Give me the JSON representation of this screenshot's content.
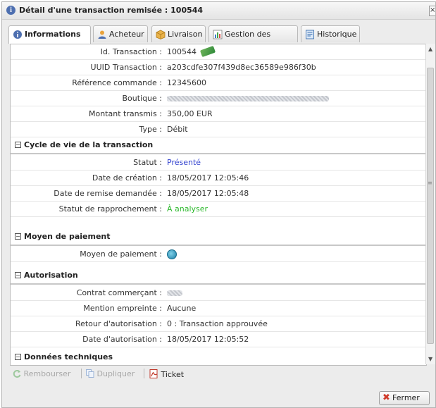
{
  "window": {
    "title": "Détail d'une transaction remisée : 100544",
    "close_glyph": "×"
  },
  "tabs": [
    {
      "label": "Informations",
      "icon": "info-icon",
      "active": true
    },
    {
      "label": "Acheteur",
      "icon": "user-icon"
    },
    {
      "label": "Livraison",
      "icon": "package-icon"
    },
    {
      "label": "Gestion des risques",
      "icon": "chart-icon"
    },
    {
      "label": "Historique",
      "icon": "history-icon"
    }
  ],
  "info": [
    {
      "label": "Id. Transaction :",
      "value": "100544"
    },
    {
      "label": "UUID Transaction :",
      "value": "a203cdfe307f439d8ec36589e986f30b"
    },
    {
      "label": "Référence commande :",
      "value": "12345600"
    },
    {
      "label": "Boutique :",
      "value": ""
    },
    {
      "label": "Montant transmis :",
      "value": "350,00 EUR"
    },
    {
      "label": "Type :",
      "value": "Débit"
    }
  ],
  "sections": {
    "cycle": "Cycle de vie de la transaction",
    "moyen": "Moyen de paiement",
    "autorisation": "Autorisation",
    "donnees": "Données techniques"
  },
  "cycle": [
    {
      "label": "Statut :",
      "value": "Présenté"
    },
    {
      "label": "Date de création :",
      "value": "18/05/2017 12:05:46"
    },
    {
      "label": "Date de remise demandée :",
      "value": "18/05/2017 12:05:48"
    },
    {
      "label": "Statut de rapprochement :",
      "value": "À analyser"
    }
  ],
  "moyen": [
    {
      "label": "Moyen de paiement :",
      "value": ""
    }
  ],
  "autorisation": [
    {
      "label": "Contrat commerçant :",
      "value": ""
    },
    {
      "label": "Mention empreinte :",
      "value": "Aucune"
    },
    {
      "label": "Retour d'autorisation :",
      "value": "0 : Transaction approuvée"
    },
    {
      "label": "Date d'autorisation :",
      "value": "18/05/2017 12:05:52"
    }
  ],
  "toolbar": {
    "rembourser": "Rembourser",
    "dupliquer": "Dupliquer",
    "ticket": "Ticket"
  },
  "footer": {
    "fermer": "Fermer"
  },
  "colors": {
    "status_blue": "#2f3fce",
    "status_green": "#2bb82b",
    "close_red": "#d03a2a"
  }
}
